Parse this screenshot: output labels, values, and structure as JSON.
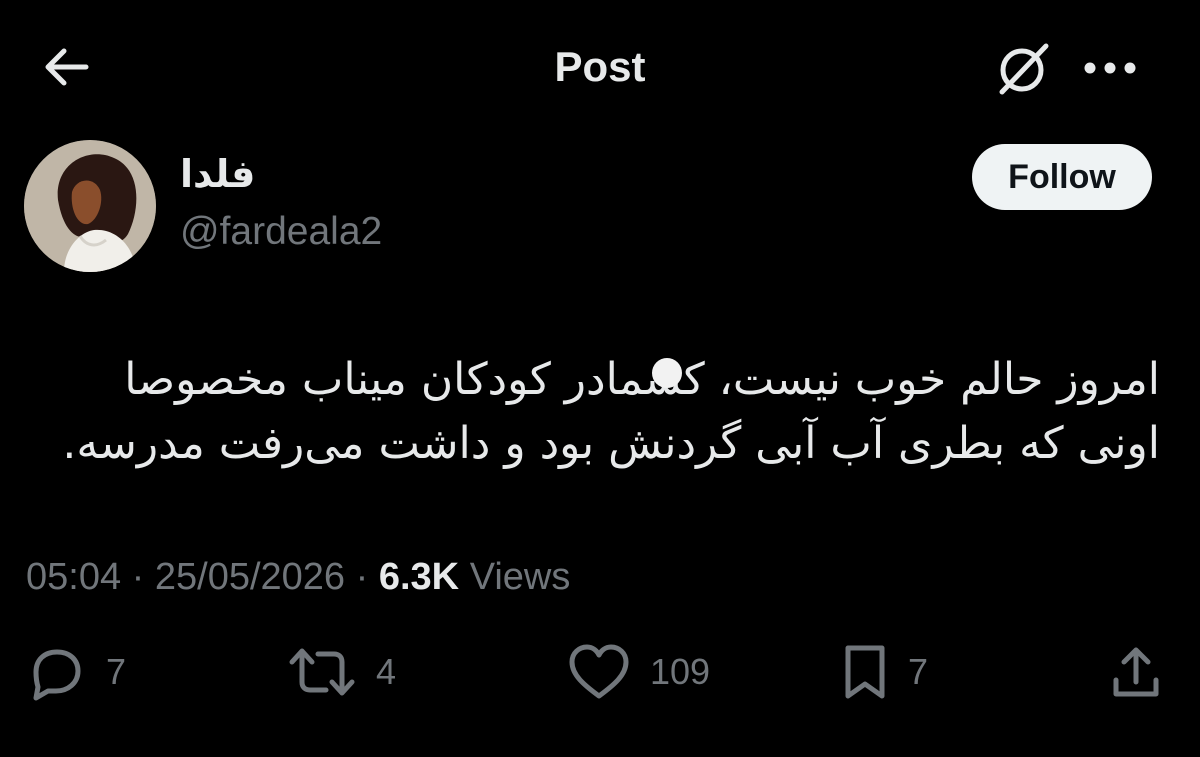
{
  "header": {
    "title": "Post",
    "back_icon": "arrow-left-icon",
    "grok_icon": "grok-icon",
    "more_icon": "more-horizontal-icon"
  },
  "author": {
    "display_name": "فلدا",
    "handle": "@fardeala2",
    "follow_label": "Follow"
  },
  "tweet": {
    "lines": [
      "امروز حالم خوب نیست، کشمادر کودکان میناب مخصوصا",
      "اونی که بطری آب آبی گردنش بود و داشت می‌رفت مدرسه."
    ]
  },
  "meta": {
    "time": "05:04",
    "date": "25/05/2026",
    "views_count": "6.3K",
    "views_label": "Views",
    "separator": "·"
  },
  "actions": {
    "replies": "7",
    "reposts": "4",
    "likes": "109",
    "bookmarks": "7"
  },
  "colors": {
    "background": "#000000",
    "text_primary": "#e7e9ea",
    "text_secondary": "#71767b",
    "follow_bg": "#eff3f4",
    "follow_text": "#0f1419"
  }
}
